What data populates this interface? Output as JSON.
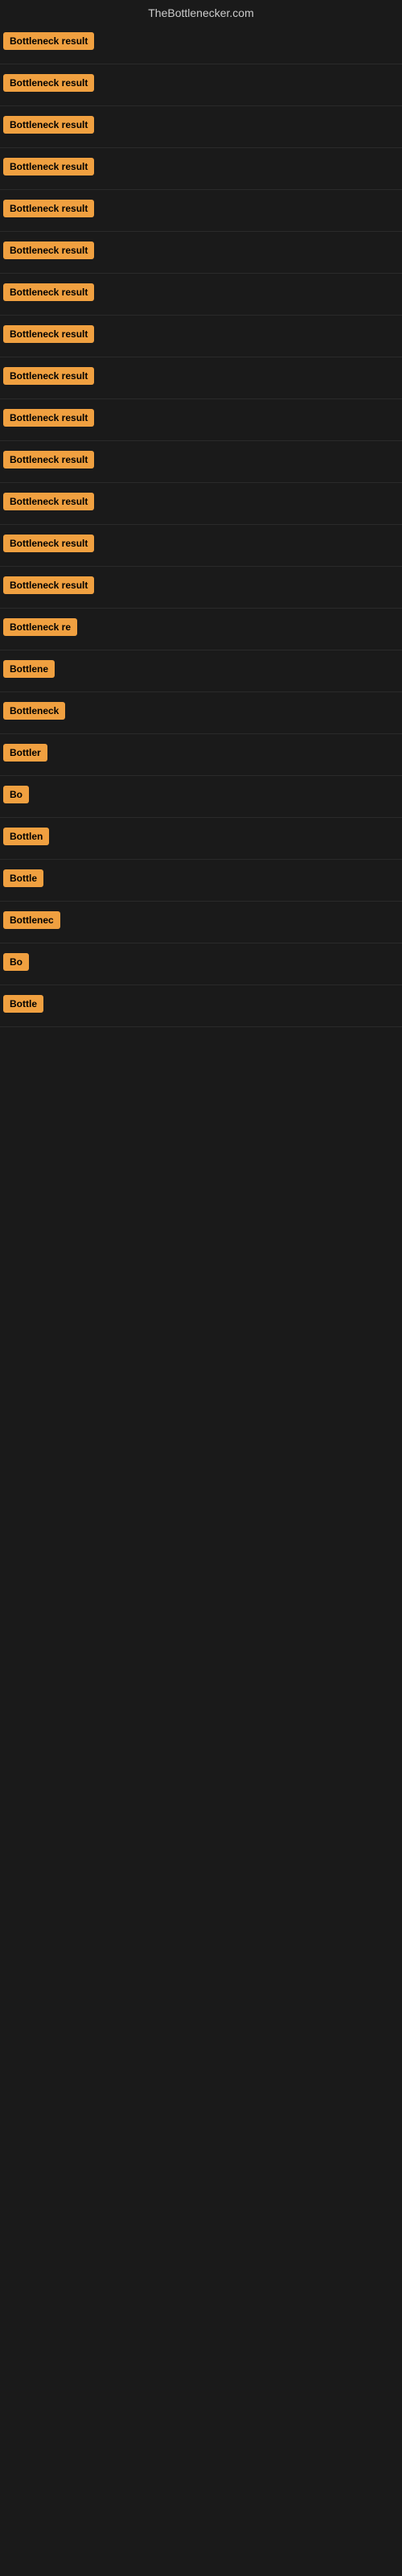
{
  "site": {
    "title": "TheBottlenecker.com"
  },
  "results": [
    {
      "id": 1,
      "label": "Bottleneck result",
      "visible_text": "Bottleneck result"
    },
    {
      "id": 2,
      "label": "Bottleneck result",
      "visible_text": "Bottleneck result"
    },
    {
      "id": 3,
      "label": "Bottleneck result",
      "visible_text": "Bottleneck result"
    },
    {
      "id": 4,
      "label": "Bottleneck result",
      "visible_text": "Bottleneck result"
    },
    {
      "id": 5,
      "label": "Bottleneck result",
      "visible_text": "Bottleneck result"
    },
    {
      "id": 6,
      "label": "Bottleneck result",
      "visible_text": "Bottleneck result"
    },
    {
      "id": 7,
      "label": "Bottleneck result",
      "visible_text": "Bottleneck result"
    },
    {
      "id": 8,
      "label": "Bottleneck result",
      "visible_text": "Bottleneck result"
    },
    {
      "id": 9,
      "label": "Bottleneck result",
      "visible_text": "Bottleneck result"
    },
    {
      "id": 10,
      "label": "Bottleneck result",
      "visible_text": "Bottleneck result"
    },
    {
      "id": 11,
      "label": "Bottleneck result",
      "visible_text": "Bottleneck result"
    },
    {
      "id": 12,
      "label": "Bottleneck result",
      "visible_text": "Bottleneck result"
    },
    {
      "id": 13,
      "label": "Bottleneck result",
      "visible_text": "Bottleneck result"
    },
    {
      "id": 14,
      "label": "Bottleneck result",
      "visible_text": "Bottleneck result"
    },
    {
      "id": 15,
      "label": "Bottleneck re",
      "visible_text": "Bottleneck re"
    },
    {
      "id": 16,
      "label": "Bottlene",
      "visible_text": "Bottlene"
    },
    {
      "id": 17,
      "label": "Bottleneck",
      "visible_text": "Bottleneck"
    },
    {
      "id": 18,
      "label": "Bottler",
      "visible_text": "Bottler"
    },
    {
      "id": 19,
      "label": "Bo",
      "visible_text": "Bo"
    },
    {
      "id": 20,
      "label": "Bottlen",
      "visible_text": "Bottlen"
    },
    {
      "id": 21,
      "label": "Bottle",
      "visible_text": "Bottle"
    },
    {
      "id": 22,
      "label": "Bottlenec",
      "visible_text": "Bottlenec"
    },
    {
      "id": 23,
      "label": "Bo",
      "visible_text": "Bo"
    },
    {
      "id": 24,
      "label": "Bottle",
      "visible_text": "Bottle"
    }
  ]
}
